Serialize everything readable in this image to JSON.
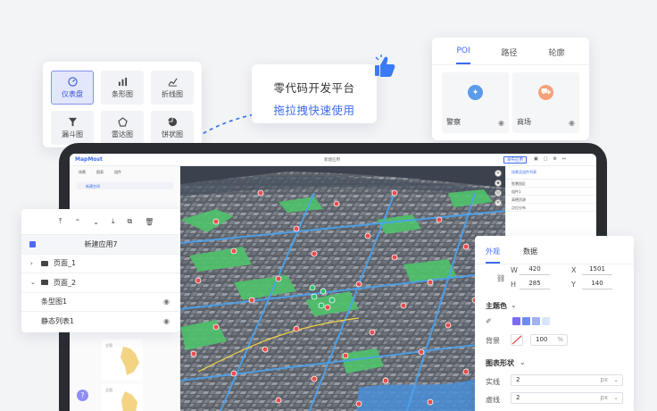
{
  "palette": {
    "items": [
      {
        "label": "仪表盘",
        "icon": "gauge-icon",
        "active": true
      },
      {
        "label": "条形图",
        "icon": "bar-chart-icon"
      },
      {
        "label": "折线图",
        "icon": "line-chart-icon"
      },
      {
        "label": "漏斗图",
        "icon": "funnel-icon"
      },
      {
        "label": "雷达图",
        "icon": "radar-icon"
      },
      {
        "label": "饼状图",
        "icon": "pie-chart-icon"
      }
    ]
  },
  "slogan": {
    "line1": "零代码开发平台",
    "line2": "拖拉拽快速使用"
  },
  "poi": {
    "tabs": [
      "POI",
      "路径",
      "轮廓"
    ],
    "cards": [
      {
        "name": "警察",
        "color": "#5b9be8",
        "icon": "police-icon"
      },
      {
        "name": "商场",
        "color": "#f5a27a",
        "icon": "shopping-cart-icon"
      }
    ]
  },
  "editor": {
    "logo": "MapMost",
    "title": "新建应用",
    "publish": "发布应用",
    "left_tabs": [
      "场景",
      "图表",
      "组件"
    ],
    "chip": "新建空间",
    "minis": [
      {
        "label": "全国"
      },
      {
        "label": "全国"
      }
    ],
    "right_header": "场景及组件列表",
    "right_rows": [
      "智慧园区",
      "组件1",
      "高德资源",
      "点位分布"
    ]
  },
  "layers": {
    "app_name": "新建应用7",
    "pages": [
      "页面_1",
      "页面_2"
    ],
    "items": [
      "条型图1",
      "静态列表1"
    ]
  },
  "props": {
    "tabs": [
      "外观",
      "数据"
    ],
    "w": "420",
    "x": "1501",
    "h": "285",
    "y": "140",
    "labels": {
      "w": "W",
      "x": "X",
      "h": "H",
      "y": "Y"
    },
    "theme_label": "主题色",
    "theme_colors": [
      "#7b6cf6",
      "#6d8bf5",
      "#9fb1f7",
      "#d8e6fb"
    ],
    "bg_label": "背景",
    "bg_opacity": "100",
    "bg_unit": "%",
    "shape_label": "图表形状",
    "solid_label": "实线",
    "solid_value": "2",
    "dash_label": "虚线",
    "dash_value": "2",
    "unit": "px"
  }
}
